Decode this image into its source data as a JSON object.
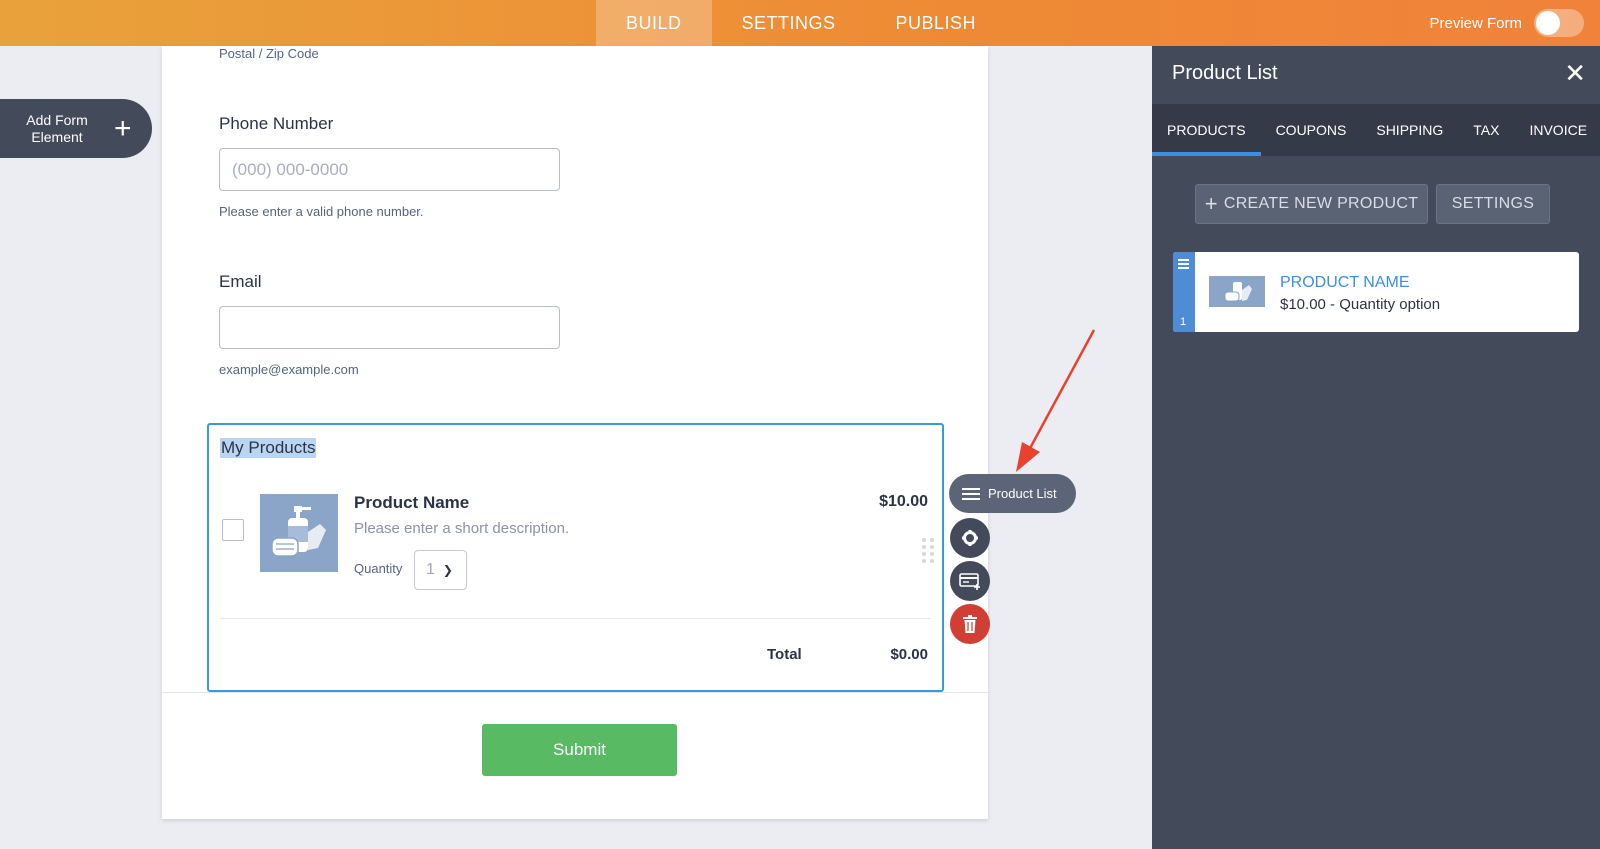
{
  "topbar": {
    "tabs": [
      {
        "label": "BUILD",
        "active": true
      },
      {
        "label": "SETTINGS",
        "active": false
      },
      {
        "label": "PUBLISH",
        "active": false
      }
    ],
    "preview_label": "Preview Form",
    "preview_on": false
  },
  "add_element": {
    "label_line1": "Add Form",
    "label_line2": "Element",
    "icon": "plus-icon"
  },
  "form": {
    "postal_sublabel": "Postal / Zip Code",
    "phone": {
      "label": "Phone Number",
      "placeholder": "(000) 000-0000",
      "sublabel": "Please enter a valid phone number."
    },
    "email": {
      "label": "Email",
      "placeholder": "",
      "sublabel": "example@example.com"
    },
    "products": {
      "title": "My Products",
      "item": {
        "name": "Product Name",
        "description": "Please enter a short description.",
        "price": "$10.00",
        "quantity_label": "Quantity",
        "quantity_value": "1"
      },
      "total_label": "Total",
      "total_value": "$0.00"
    },
    "submit_label": "Submit"
  },
  "tools": {
    "product_list_label": "Product List",
    "icons": [
      "list-icon",
      "gear-icon",
      "payment-card-icon",
      "trash-icon"
    ]
  },
  "panel": {
    "title": "Product List",
    "tabs": [
      {
        "label": "PRODUCTS",
        "active": true
      },
      {
        "label": "COUPONS",
        "active": false
      },
      {
        "label": "SHIPPING",
        "active": false
      },
      {
        "label": "TAX",
        "active": false
      },
      {
        "label": "INVOICE",
        "active": false
      }
    ],
    "create_label": "CREATE NEW PRODUCT",
    "settings_label": "SETTINGS",
    "product": {
      "index": "1",
      "name": "PRODUCT NAME",
      "meta": "$10.00 - Quantity option"
    }
  },
  "colors": {
    "accent": "#ee8a35",
    "panel": "#434a5a",
    "link": "#3a8ee6",
    "submit": "#58bb63",
    "delete": "#d03e34"
  }
}
